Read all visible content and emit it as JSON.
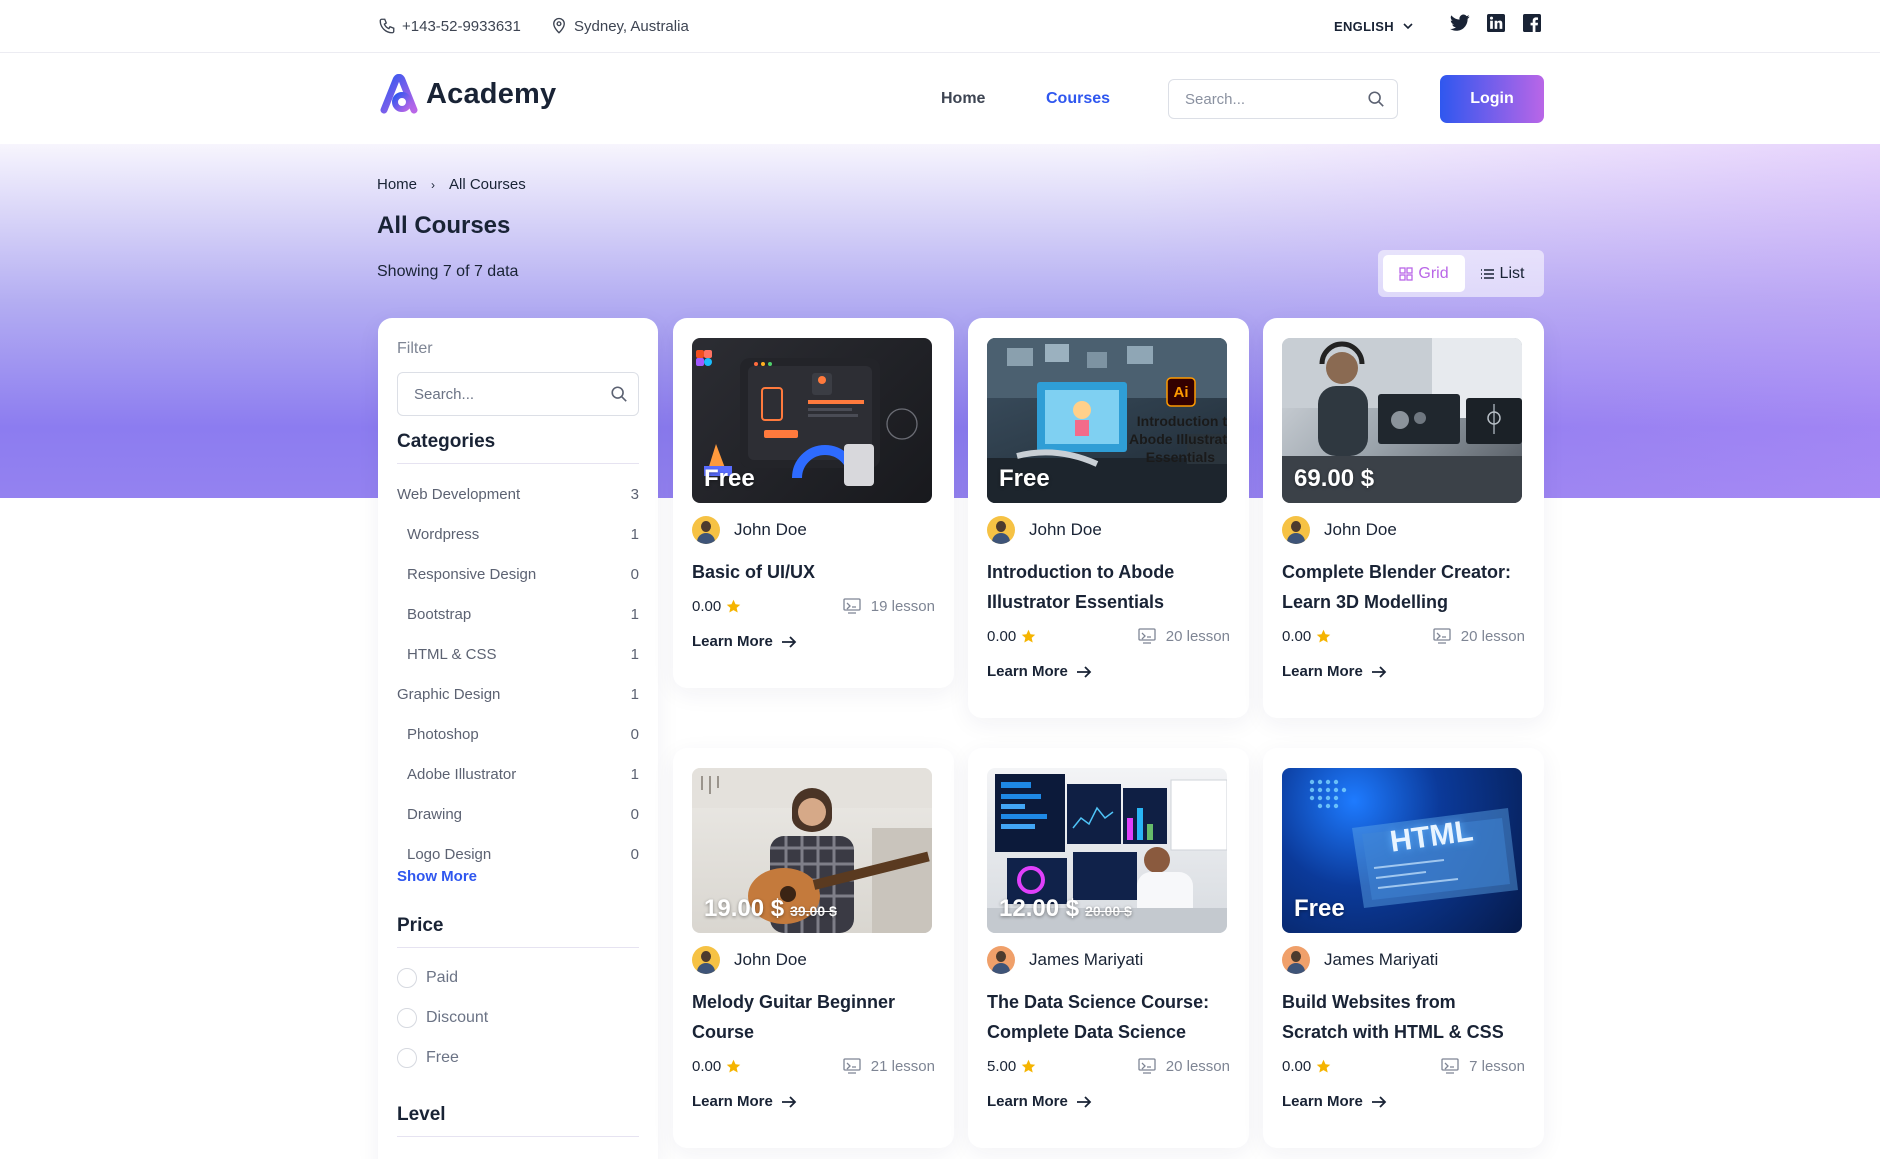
{
  "topbar": {
    "phone": "+143-52-9933631",
    "location": "Sydney, Australia",
    "language": "ENGLISH",
    "social": [
      "twitter-icon",
      "linkedin-icon",
      "facebook-icon"
    ]
  },
  "header": {
    "logo": "Academy",
    "nav": [
      {
        "label": "Home",
        "active": false
      },
      {
        "label": "Courses",
        "active": true
      }
    ],
    "search_placeholder": "Search...",
    "login": "Login"
  },
  "colors": {
    "primary": "#2f57ef",
    "accent": "#b966e7",
    "text": "#192335",
    "star": "#f5b401"
  },
  "breadcrumb": {
    "home": "Home",
    "separator": "›",
    "current": "All Courses"
  },
  "page": {
    "title": "All Courses",
    "showing": "Showing 7 of 7 data",
    "view_grid": "Grid",
    "view_list": "List"
  },
  "sidebar": {
    "filter_label": "Filter",
    "search_placeholder": "Search...",
    "categories_heading": "Categories",
    "categories": [
      {
        "label": "Web Development",
        "count": "3",
        "sub": false
      },
      {
        "label": "Wordpress",
        "count": "1",
        "sub": true
      },
      {
        "label": "Responsive Design",
        "count": "0",
        "sub": true
      },
      {
        "label": "Bootstrap",
        "count": "1",
        "sub": true
      },
      {
        "label": "HTML & CSS",
        "count": "1",
        "sub": true
      },
      {
        "label": "Graphic Design",
        "count": "1",
        "sub": false
      },
      {
        "label": "Photoshop",
        "count": "0",
        "sub": true
      },
      {
        "label": "Adobe Illustrator",
        "count": "1",
        "sub": true
      },
      {
        "label": "Drawing",
        "count": "0",
        "sub": true
      },
      {
        "label": "Logo Design",
        "count": "0",
        "sub": true
      }
    ],
    "show_more": "Show More",
    "price_heading": "Price",
    "price_options": [
      "Paid",
      "Discount",
      "Free"
    ],
    "level_heading": "Level"
  },
  "courses": [
    {
      "price": "Free",
      "old_price": "",
      "author": "John Doe",
      "title_lines": [
        "Basic of UI/UX"
      ],
      "rating": "0.00",
      "lessons": "19 lesson",
      "learn": "Learn More",
      "thumb": "uiux"
    },
    {
      "price": "Free",
      "old_price": "",
      "author": "John Doe",
      "title_lines": [
        "Introduction to Abode",
        "Illustrator Essentials"
      ],
      "rating": "0.00",
      "lessons": "20 lesson",
      "learn": "Learn More",
      "thumb": "illustrator",
      "thumb_badge": "Ai",
      "thumb_caption": [
        "Introduction t",
        "Abode Illustrat",
        "Essentials"
      ]
    },
    {
      "price": "69.00 $",
      "old_price": "",
      "author": "John Doe",
      "title_lines": [
        "Complete Blender Creator:",
        "Learn 3D Modelling"
      ],
      "rating": "0.00",
      "lessons": "20 lesson",
      "learn": "Learn More",
      "thumb": "blender"
    },
    {
      "price": "19.00 $",
      "old_price": "39.00 $",
      "author": "John Doe",
      "title_lines": [
        "Melody Guitar Beginner",
        "Course"
      ],
      "rating": "0.00",
      "lessons": "21 lesson",
      "learn": "Learn More",
      "thumb": "guitar"
    },
    {
      "price": "12.00 $",
      "old_price": "20.00 $",
      "author": "James Mariyati",
      "title_lines": [
        "The Data Science Course:",
        "Complete Data Science"
      ],
      "rating": "5.00",
      "lessons": "20 lesson",
      "learn": "Learn More",
      "thumb": "data"
    },
    {
      "price": "Free",
      "old_price": "",
      "author": "James Mariyati",
      "title_lines": [
        "Build Websites from",
        "Scratch with HTML & CSS"
      ],
      "rating": "0.00",
      "lessons": "7 lesson",
      "learn": "Learn More",
      "thumb": "html",
      "thumb_text": "HTML"
    }
  ]
}
